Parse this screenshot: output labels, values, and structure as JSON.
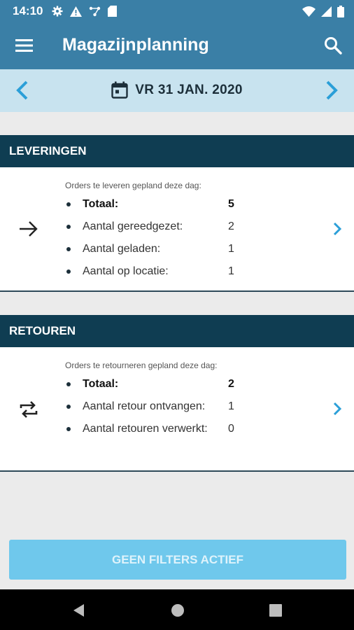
{
  "status_bar": {
    "time": "14:10",
    "icons_left": [
      "gear-icon",
      "warning-icon",
      "network-icon",
      "sd-card-icon"
    ],
    "icons_right": [
      "wifi-icon",
      "signal-icon",
      "battery-icon"
    ]
  },
  "app_bar": {
    "title": "Magazijnplanning",
    "menu_icon": "hamburger-menu-icon",
    "search_icon": "search-icon"
  },
  "date_bar": {
    "date": "VR 31 JAN. 2020",
    "calendar_icon": "calendar-icon"
  },
  "deliveries": {
    "header": "LEVERINGEN",
    "caption": "Orders te leveren gepland deze dag:",
    "icon": "arrow-right-icon",
    "rows": [
      {
        "label": "Totaal:",
        "value": "5"
      },
      {
        "label": "Aantal gereedgezet:",
        "value": "2"
      },
      {
        "label": "Aantal geladen:",
        "value": "1"
      },
      {
        "label": "Aantal op locatie:",
        "value": "1"
      }
    ]
  },
  "returns": {
    "header": "RETOUREN",
    "caption": "Orders te retourneren gepland deze dag:",
    "icon": "repeat-icon",
    "rows": [
      {
        "label": "Totaal:",
        "value": "2"
      },
      {
        "label": "Aantal retour ontvangen:",
        "value": "1"
      },
      {
        "label": "Aantal retouren verwerkt:",
        "value": "0"
      }
    ]
  },
  "filter_button": {
    "label": "GEEN FILTERS ACTIEF"
  },
  "colors": {
    "app_bar": "#3a7fa6",
    "date_bar": "#c8e3ef",
    "section_header": "#0f3d52",
    "accent": "#2b9fd8",
    "button": "#6fc8ec"
  }
}
